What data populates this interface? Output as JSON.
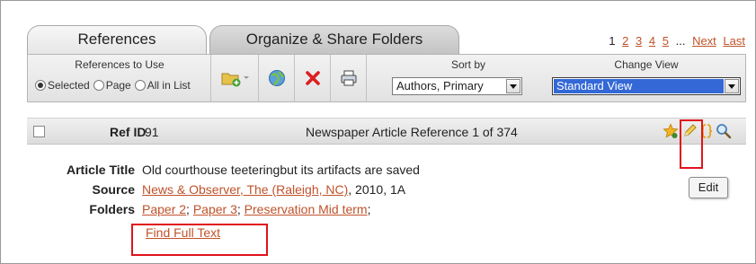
{
  "tabs": {
    "references": "References",
    "organize": "Organize & Share Folders"
  },
  "pager": {
    "current": "1",
    "pages": [
      "2",
      "3",
      "4",
      "5"
    ],
    "ellipsis": "...",
    "next": "Next",
    "last": "Last"
  },
  "toolbar": {
    "refs_to_use_title": "References to Use",
    "radios": [
      {
        "label": "Selected",
        "checked": true
      },
      {
        "label": "Page",
        "checked": false
      },
      {
        "label": "All in List",
        "checked": false
      }
    ],
    "icons": [
      "folder-add-icon",
      "globe-icon",
      "delete-icon",
      "print-icon"
    ],
    "sort_title": "Sort by",
    "sort_value": "Authors, Primary",
    "view_title": "Change View",
    "view_value": "Standard View"
  },
  "ref": {
    "id_label": "Ref ID",
    "id_value": "91",
    "count_text": "Newspaper Article Reference 1 of 374",
    "action_icons": [
      "star-icon",
      "edit-pencil-icon",
      "braces-icon",
      "magnifier-icon"
    ]
  },
  "details": {
    "article_title_label": "Article Title",
    "article_title_value": "Old courthouse teeteringbut its artifacts are saved",
    "source_label": "Source",
    "source_link": "News & Observer, The (Raleigh, NC)",
    "source_rest": ", 2010, 1A",
    "folders_label": "Folders",
    "folders": [
      "Paper 2",
      "Paper 3",
      "Preservation Mid term"
    ],
    "find_full_text": "Find Full Text"
  },
  "tooltip": "Edit",
  "colors": {
    "link": "#c0522a",
    "highlight": "#e0141b",
    "select_blue": "#3368d6"
  }
}
